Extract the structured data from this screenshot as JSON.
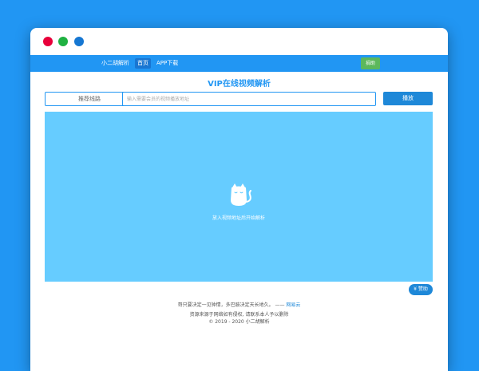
{
  "nav": {
    "brand": "小二胡解析",
    "items": [
      {
        "label": "首页"
      },
      {
        "label": "APP下载"
      }
    ],
    "donate_label": "捐助"
  },
  "main": {
    "title": "VIP在线视频解析",
    "route_button_label": "推荐线路",
    "url_placeholder": "输入需要会员的视频播放地址",
    "play_button_label": "播放"
  },
  "player": {
    "hint": "放入视频地址后开始解析"
  },
  "donate_badge_label": "¥ 赞助",
  "footer": {
    "quote": "哥只要决定一见钟情，多巴胺决定天长地久。 —— ",
    "quote_author": "网易云",
    "disclaimer": "资源来源于网络如有侵权, 请联系本人予以删除",
    "copyright": "© 2019 - 2020 小二胡解析"
  },
  "colors": {
    "background": "#2196f3",
    "navbar": "#2196f3",
    "player": "#66ccff",
    "donate_top": "#5cb85c",
    "accent": "#1e88d8"
  }
}
